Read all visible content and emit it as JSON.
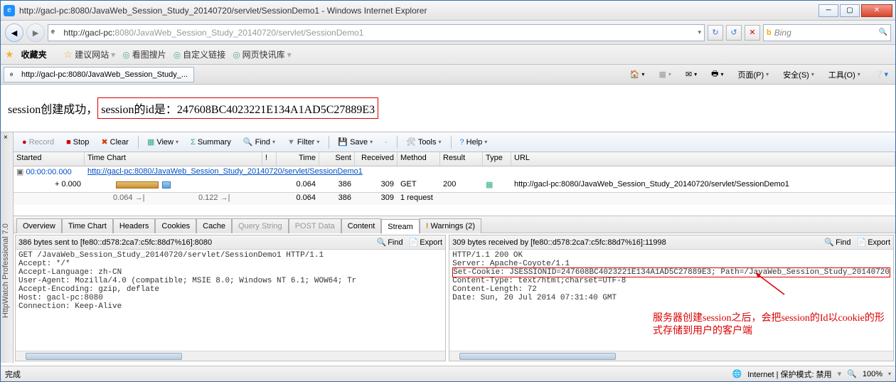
{
  "window": {
    "title": "http://gacl-pc:8080/JavaWeb_Session_Study_20140720/servlet/SessionDemo1 - Windows Internet Explorer"
  },
  "address": {
    "prefix": "http://gacl-pc:",
    "port": "8080",
    "path": "/JavaWeb_Session_Study_20140720/servlet/SessionDemo1"
  },
  "search": {
    "engine": "Bing",
    "placeholder": ""
  },
  "favbar": {
    "fav_label": "收藏夹",
    "links": [
      "建议网站",
      "看图搜片",
      "自定义链接",
      "网页快讯库"
    ]
  },
  "tab": {
    "title": "http://gacl-pc:8080/JavaWeb_Session_Study_..."
  },
  "commandbar": {
    "page": "页面(P)",
    "safety": "安全(S)",
    "tools": "工具(O)"
  },
  "page_content": {
    "prefix": "session创建成功，",
    "boxed": "session的id是：247608BC4023221E134A1AD5C27889E3"
  },
  "hw": {
    "sidebar_label": "HttpWatch Professional 7.0",
    "toolbar": {
      "record": "Record",
      "stop": "Stop",
      "clear": "Clear",
      "view": "View",
      "summary": "Summary",
      "find": "Find",
      "filter": "Filter",
      "save": "Save",
      "tools": "Tools",
      "help": "Help"
    },
    "grid": {
      "headers": {
        "started": "Started",
        "tc": "Time Chart",
        "ex": "!",
        "time": "Time",
        "sent": "Sent",
        "recv": "Received",
        "meth": "Method",
        "res": "Result",
        "type": "Type",
        "url": "URL"
      },
      "group_time": "00:00:00.000",
      "group_url": "http://gacl-pc:8080/JavaWeb_Session_Study_20140720/servlet/SessionDemo1",
      "rows": [
        {
          "started": "+ 0.000",
          "t1": "0.064",
          "t2": "0.122",
          "time": "0.064",
          "sent": "386",
          "recv": "309",
          "meth": "GET",
          "res": "200",
          "url": "http://gacl-pc:8080/JavaWeb_Session_Study_20140720/servlet/SessionDemo1"
        }
      ],
      "summary": {
        "time": "0.064",
        "sent": "386",
        "recv": "309",
        "meth": "1 request"
      }
    },
    "tabs": [
      "Overview",
      "Time Chart",
      "Headers",
      "Cookies",
      "Cache",
      "Query String",
      "POST Data",
      "Content",
      "Stream",
      "Warnings (2)"
    ],
    "active_tab": "Stream",
    "req_panel": {
      "title": "386 bytes sent to [fe80::d578:2ca7:c5fc:88d7%16]:8080",
      "find": "Find",
      "export": "Export",
      "body": "GET /JavaWeb_Session_Study_20140720/servlet/SessionDemo1 HTTP/1.1\nAccept: */*\nAccept-Language: zh-CN\nUser-Agent: Mozilla/4.0 (compatible; MSIE 8.0; Windows NT 6.1; WOW64; Tr\nAccept-Encoding: gzip, deflate\nHost: gacl-pc:8080\nConnection: Keep-Alive"
    },
    "res_panel": {
      "title": "309 bytes received by [fe80::d578:2ca7:c5fc:88d7%16]:11998",
      "find": "Find",
      "export": "Export",
      "body_pre": "HTTP/1.1 200 OK\nServer: Apache-Coyote/1.1",
      "body_hl": "Set-Cookie: JSESSIONID=247608BC4023221E134A1AD5C27889E3; Path=/JavaWeb_Session_Study_20140720",
      "body_post": "Content-Type: text/html;charset=UTF-8\nContent-Length: 72\nDate: Sun, 20 Jul 2014 07:31:40 GMT",
      "annotation": "服务器创建session之后，会把session的Id以cookie的形式存储到用户的客户端"
    }
  },
  "statusbar": {
    "done": "完成",
    "zone": "Internet | 保护模式: 禁用",
    "zoom": "100%"
  }
}
